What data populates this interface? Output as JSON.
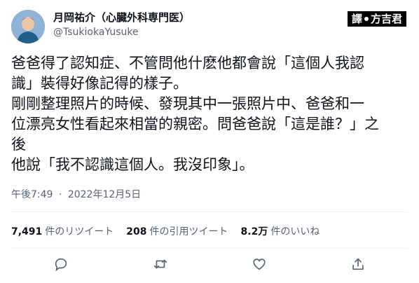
{
  "author": {
    "name": "月岡祐介（心臓外科専門医）",
    "handle": "@TsukiokaYusuke"
  },
  "badge": {
    "left": "譯",
    "right": "方吉君"
  },
  "tweet": {
    "lines": [
      "爸爸得了認知症、不管問他什麽他都會說「這個人我認",
      "識」裝得好像記得的樣子。",
      "剛剛整理照片的時候、發現其中一張照片中、爸爸和一",
      "位漂亮女性看起來相當的親密。問爸爸說「這是誰？」之",
      "後",
      "他說「我不認識這個人。我沒印象」。"
    ]
  },
  "meta": {
    "time": "午後7:49",
    "separator": "·",
    "date": "2022年12月5日"
  },
  "stats": {
    "retweets_count": "7,491",
    "retweets_label": "件のリツイート",
    "quotes_count": "208",
    "quotes_label": "件の引用ツイート",
    "likes_count": "8.2万",
    "likes_label": "件のいいね"
  },
  "icons": {
    "reply": "reply-icon",
    "retweet": "retweet-icon",
    "like": "like-icon",
    "share": "share-icon"
  },
  "colors": {
    "secondary_text": "#536471",
    "primary_text": "#0f1419",
    "divider": "#eff3f4"
  }
}
